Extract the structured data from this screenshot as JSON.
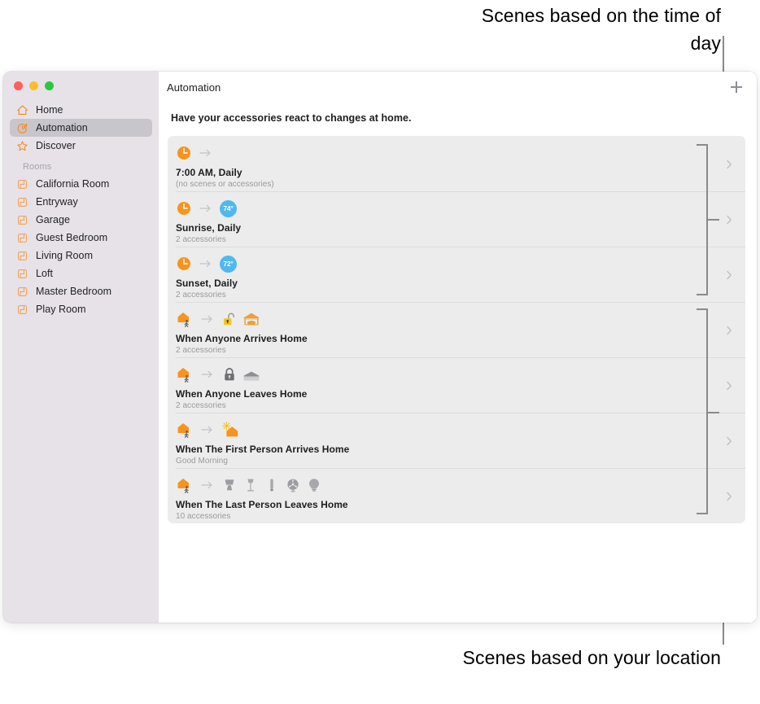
{
  "annotations": {
    "top": "Scenes based on the time of day",
    "bottom": "Scenes based on your location"
  },
  "window": {
    "traffic_lights": {
      "close_color": "#ff5f57",
      "minimize_color": "#febc2e",
      "zoom_color": "#28c840"
    }
  },
  "sidebar": {
    "background": "#e6e2e8",
    "items": [
      {
        "label": "Home",
        "icon": "house-icon",
        "selected": false
      },
      {
        "label": "Automation",
        "icon": "automation-clock-icon",
        "selected": true
      },
      {
        "label": "Discover",
        "icon": "star-icon",
        "selected": false
      }
    ],
    "rooms_header": "Rooms",
    "rooms": [
      {
        "label": "California Room",
        "icon": "room-icon"
      },
      {
        "label": "Entryway",
        "icon": "room-icon"
      },
      {
        "label": "Garage",
        "icon": "room-icon"
      },
      {
        "label": "Guest Bedroom",
        "icon": "room-icon"
      },
      {
        "label": "Living Room",
        "icon": "room-icon"
      },
      {
        "label": "Loft",
        "icon": "room-icon"
      },
      {
        "label": "Master Bedroom",
        "icon": "room-icon"
      },
      {
        "label": "Play Room",
        "icon": "room-icon"
      }
    ]
  },
  "toolbar": {
    "title": "Automation",
    "add_label": "+",
    "add_icon": "plus-icon"
  },
  "main": {
    "subtitle": "Have your accessories react to changes at home.",
    "automations": [
      {
        "title": "7:00 AM, Daily",
        "subtitle": "(no scenes or accessories)",
        "trigger_icon": "clock-icon",
        "accessory_icons": []
      },
      {
        "title": "Sunrise, Daily",
        "subtitle": "2 accessories",
        "trigger_icon": "clock-icon",
        "accessory_icons": [
          "thermostat-badge"
        ],
        "temperature": "74°"
      },
      {
        "title": "Sunset, Daily",
        "subtitle": "2 accessories",
        "trigger_icon": "clock-icon",
        "accessory_icons": [
          "thermostat-badge"
        ],
        "temperature": "72°"
      },
      {
        "title": "When Anyone Arrives Home",
        "subtitle": "2 accessories",
        "trigger_icon": "person-arrives-home-icon",
        "accessory_icons": [
          "lock-unlocked-icon",
          "garage-open-icon"
        ]
      },
      {
        "title": "When Anyone Leaves Home",
        "subtitle": "2 accessories",
        "trigger_icon": "person-leaves-home-icon",
        "accessory_icons": [
          "lock-locked-icon",
          "garage-closed-icon"
        ]
      },
      {
        "title": "When The First Person Arrives Home",
        "subtitle": "Good Morning",
        "trigger_icon": "person-arrives-home-icon",
        "accessory_icons": [
          "scene-good-morning-icon"
        ]
      },
      {
        "title": "When The Last Person Leaves Home",
        "subtitle": "10 accessories",
        "trigger_icon": "person-leaves-home-icon",
        "accessory_icons": [
          "table-lamp-icon",
          "floor-lamp-icon",
          "light-strip-icon",
          "fan-icon",
          "bulb-icon"
        ]
      }
    ]
  },
  "colors": {
    "accent_orange": "#f08a1e",
    "badge_blue": "#50b8ef",
    "list_background": "#ececec",
    "bracket_gray": "#8a8a8a"
  }
}
